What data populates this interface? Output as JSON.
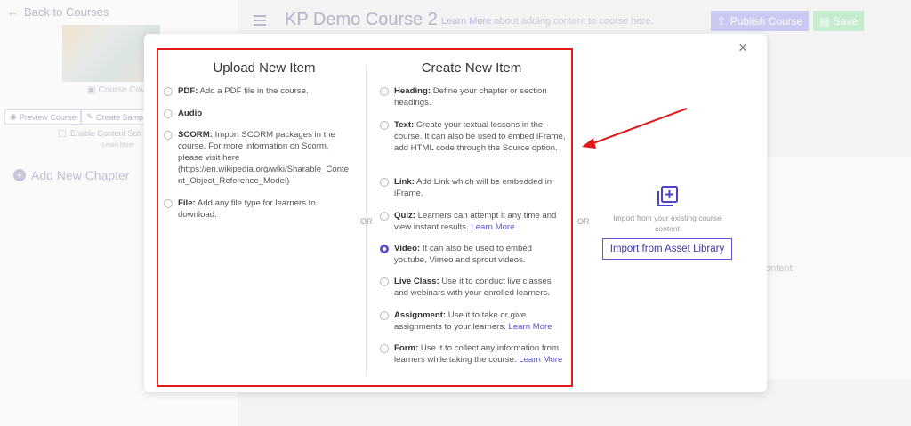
{
  "left_panel": {
    "back_link": "Back to Courses",
    "course_cover": "Course Cov",
    "preview_course": "Preview Course",
    "create_sample": "Create Samp",
    "enable_content": "Enable Content Sch",
    "learn_more": "Learn More",
    "add_chapter": "Add New Chapter"
  },
  "header": {
    "course_title": "KP Demo Course 2",
    "learn_more_link": "Learn More",
    "learn_more_note": " about adding content to course here.",
    "publish_label": "Publish Course",
    "save_label": "Save"
  },
  "background": {
    "content_label": "ontent"
  },
  "modal": {
    "close_label": "×",
    "upload": {
      "title": "Upload New Item",
      "options": [
        {
          "title": "PDF:",
          "desc": " Add a PDF file in the course."
        },
        {
          "title": "Audio",
          "desc": ""
        },
        {
          "title": "SCORM:",
          "desc": " Import SCORM packages in the course. For more information on Scorm, please visit here (https://en.wikipedia.org/wiki/Sharable_Content_Object_Reference_Model)"
        },
        {
          "title": "File:",
          "desc": " Add any file type for learners to download."
        }
      ]
    },
    "create": {
      "title": "Create New Item",
      "options": [
        {
          "title": "Heading:",
          "desc": " Define your chapter or section headings.",
          "link": ""
        },
        {
          "title": "Text:",
          "desc": " Create your textual lessons in the course. It can also be used to embed iFrame, add HTML code through the Source option.",
          "link": ""
        },
        {
          "title": "Link:",
          "desc": " Add Link which will be embedded in iFrame.",
          "link": ""
        },
        {
          "title": "Quiz:",
          "desc": " Learners can attempt it any time and view instant results. ",
          "link": "Learn More"
        },
        {
          "title": "Video:",
          "desc": " It can also be used to embed youtube, Vimeo and sprout videos.",
          "link": ""
        },
        {
          "title": "Live Class:",
          "desc": " Use it to conduct live classes and webinars with your enrolled learners.",
          "link": ""
        },
        {
          "title": "Assignment:",
          "desc": " Use it to take or give assignments to your learners. ",
          "link": "Learn More"
        },
        {
          "title": "Form:",
          "desc": " Use it to collect any information from learners while taking the course. ",
          "link": "Learn More"
        }
      ],
      "selected_index": 4
    },
    "or_label": "OR",
    "import": {
      "text": "Import from your existing course content",
      "button": "Import from Asset Library"
    }
  },
  "colors": {
    "accent": "#5b53d6",
    "highlight": "#e21a1a",
    "publish": "#c9c9f2",
    "save": "#c6ecd0"
  },
  "icons": [
    "arrow-left-icon",
    "image-icon",
    "eye-icon",
    "pencil-icon",
    "plus-circle-icon",
    "hamburger-icon",
    "upload-icon",
    "save-icon",
    "close-icon",
    "library-add-icon",
    "annotation-arrow"
  ]
}
